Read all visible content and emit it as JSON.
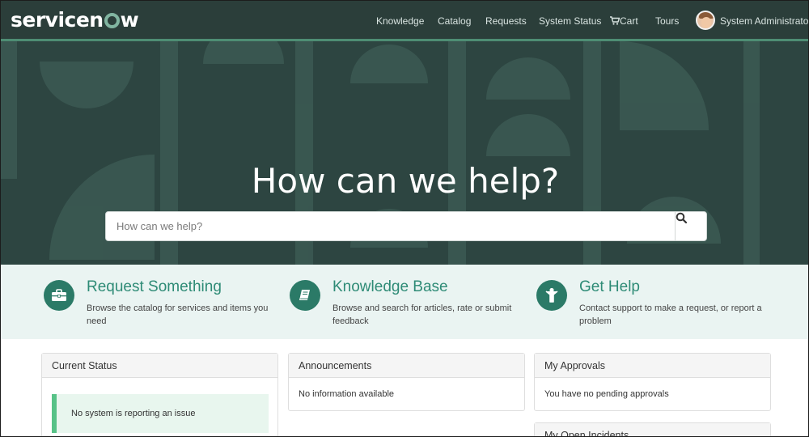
{
  "header": {
    "logo_text_pre": "servicen",
    "logo_text_post": "w",
    "nav": {
      "knowledge": "Knowledge",
      "catalog": "Catalog",
      "requests": "Requests",
      "system_status": "System Status",
      "cart": "Cart",
      "tours": "Tours"
    },
    "user_name": "System Administrator"
  },
  "hero": {
    "title": "How can we help?",
    "search_placeholder": "How can we help?"
  },
  "quick_links": [
    {
      "title": "Request Something",
      "description": "Browse the catalog for services and items you need",
      "icon": "briefcase-icon"
    },
    {
      "title": "Knowledge Base",
      "description": "Browse and search for articles, rate or submit feedback",
      "icon": "book-icon"
    },
    {
      "title": "Get Help",
      "description": "Contact support to make a request, or report a problem",
      "icon": "person-help-icon"
    }
  ],
  "panels": {
    "current_status": {
      "title": "Current Status",
      "message": "No system is reporting an issue"
    },
    "announcements": {
      "title": "Announcements",
      "message": "No information available"
    },
    "my_approvals": {
      "title": "My Approvals",
      "message": "You have no pending approvals"
    },
    "my_open_incidents": {
      "title": "My Open Incidents"
    }
  },
  "colors": {
    "header_bg": "#2b3e3a",
    "hero_bg": "#2d4541",
    "accent": "#2e8b76",
    "status_ok": "#57c287"
  }
}
